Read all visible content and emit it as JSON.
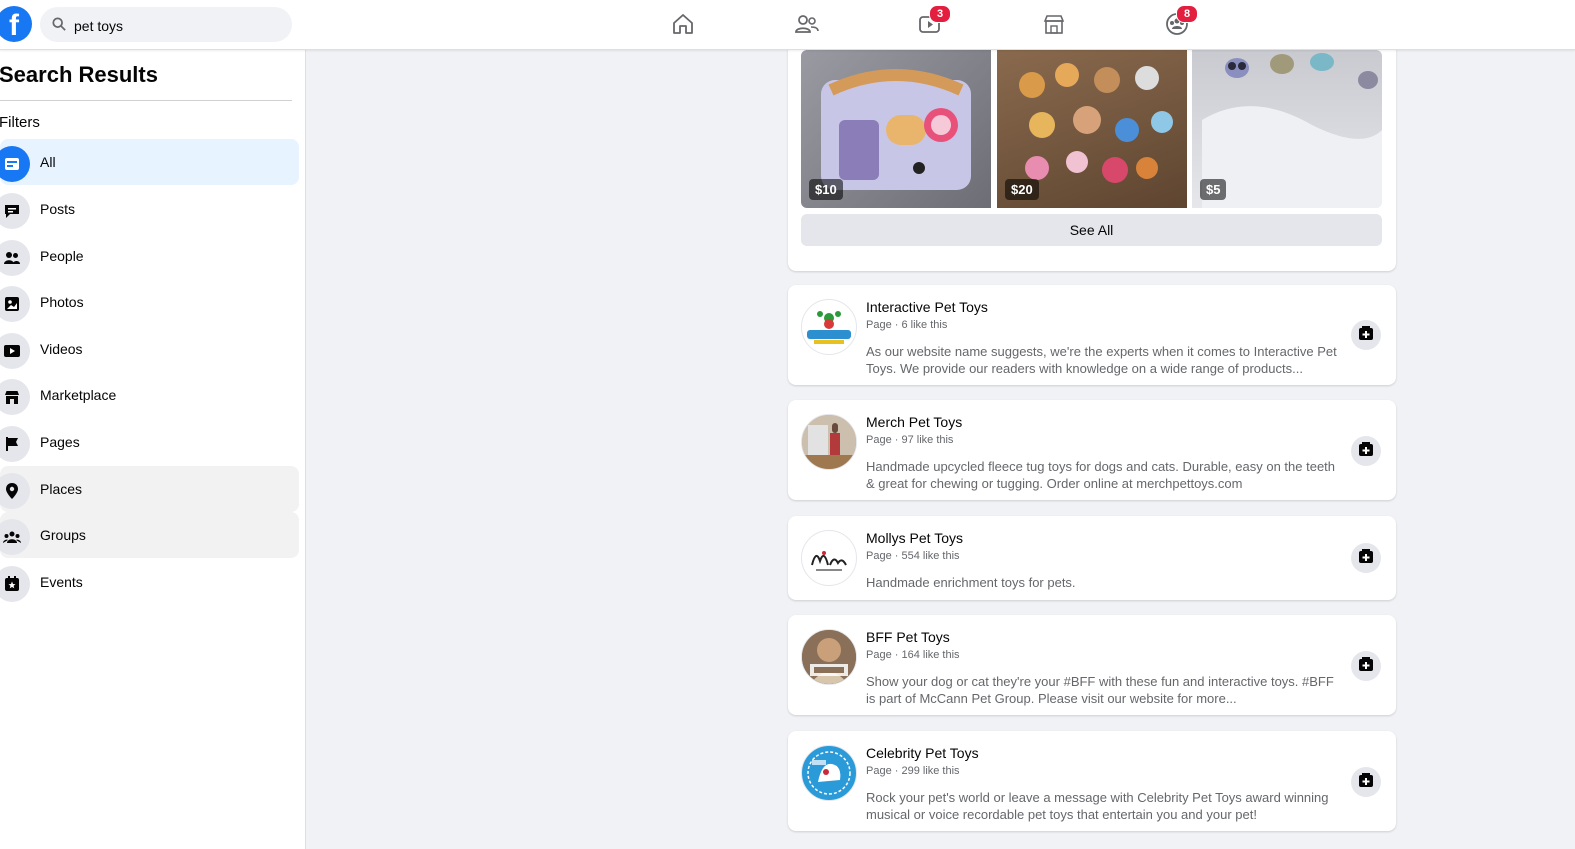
{
  "topbar": {
    "logo": "f",
    "search_value": "pet toys",
    "watch_badge": "3",
    "groups_badge": "8"
  },
  "sidebar": {
    "title": "Search Results",
    "filters_label": "Filters",
    "items": [
      {
        "label": "All",
        "icon": "all-icon"
      },
      {
        "label": "Posts",
        "icon": "posts-icon"
      },
      {
        "label": "People",
        "icon": "people-icon"
      },
      {
        "label": "Photos",
        "icon": "photos-icon"
      },
      {
        "label": "Videos",
        "icon": "videos-icon"
      },
      {
        "label": "Marketplace",
        "icon": "marketplace-icon"
      },
      {
        "label": "Pages",
        "icon": "pages-icon"
      },
      {
        "label": "Places",
        "icon": "places-icon"
      },
      {
        "label": "Groups",
        "icon": "groups-icon"
      },
      {
        "label": "Events",
        "icon": "events-icon"
      }
    ]
  },
  "marketplace": {
    "prices": [
      "$10",
      "$20",
      "$5"
    ],
    "see_all": "See All"
  },
  "pages": [
    {
      "title": "Interactive Pet Toys",
      "meta": "Page · 6 like this",
      "desc": "As our website name suggests, we're the experts when it comes to Interactive Pet Toys. We provide our readers with knowledge on a wide range of products..."
    },
    {
      "title": "Merch Pet Toys",
      "meta": "Page · 97 like this",
      "desc": "Handmade upcycled fleece tug toys for dogs and cats. Durable, easy on the teeth & great for chewing or tugging. Order online at merchpettoys.com"
    },
    {
      "title": "Mollys Pet Toys",
      "meta": "Page · 554 like this",
      "desc": "Handmade enrichment toys for pets."
    },
    {
      "title": "BFF Pet Toys",
      "meta": "Page · 164 like this",
      "desc": "Show your dog or cat they're your #BFF with these fun and interactive toys. #BFF is part of McCann Pet Group. Please visit our website for more..."
    },
    {
      "title": "Celebrity Pet Toys",
      "meta": "Page · 299 like this",
      "desc": "Rock your pet's world or leave a message with Celebrity Pet Toys award winning musical or voice recordable pet toys that entertain you and your pet!"
    }
  ],
  "colors": {
    "brand": "#1877f2",
    "badge": "#e41e3f",
    "active_bg": "#e7f3ff"
  }
}
